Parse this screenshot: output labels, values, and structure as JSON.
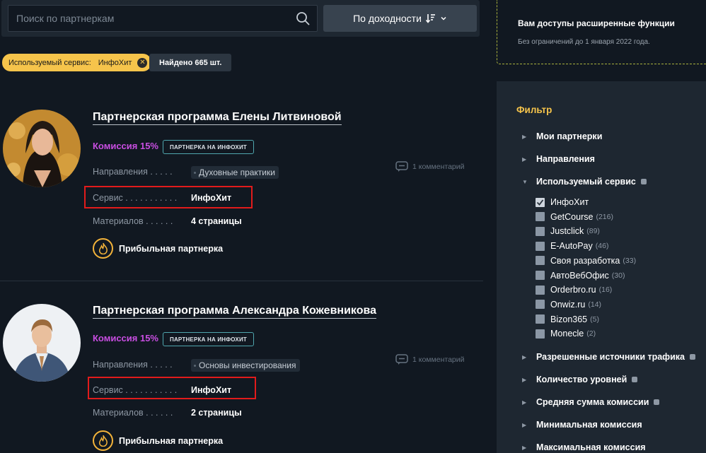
{
  "search": {
    "placeholder": "Поиск по партнеркам"
  },
  "sort": {
    "label": "По доходности"
  },
  "chips": {
    "service_label": "Используемый сервис:",
    "service_value": "ИнфоХит",
    "found": "Найдено 665 шт."
  },
  "cards": [
    {
      "title": "Партнерская программа Елены Литвиновой",
      "commission": "Комиссия 15%",
      "badge": "ПАРТНЕРКА НА ИНФОХИТ",
      "directions_label": "Направления . . . . .",
      "direction_tag": "Духовные практики",
      "service_label": "Сервис . . . . . . . . . . .",
      "service_value": "ИнфоХит",
      "materials_label": "Материалов . . . . . .",
      "materials_value": "4 страницы",
      "comments": "1 комментарий",
      "profit": "Прибыльная партнерка"
    },
    {
      "title": "Партнерская программа Александра Кожевникова",
      "commission": "Комиссия 15%",
      "badge": "ПАРТНЕРКА НА ИНФОХИТ",
      "directions_label": "Направления . . . . .",
      "direction_tag": "Основы инвестирования",
      "service_label": "Сервис . . . . . . . . . . .",
      "service_value": "ИнфоХит",
      "materials_label": "Материалов . . . . . .",
      "materials_value": "2 страницы",
      "comments": "1 комментарий",
      "profit": "Прибыльная партнерка"
    }
  ],
  "promo": {
    "title": "Вам доступы расширенные функции",
    "subtitle": "Без ограничений до 1 января 2022 года."
  },
  "filter": {
    "title": "Фильтр",
    "sections": [
      {
        "label": "Мои партнерки"
      },
      {
        "label": "Направления"
      },
      {
        "label": "Используемый сервис"
      },
      {
        "label": "Разрешенные источники трафика"
      },
      {
        "label": "Количество уровней"
      },
      {
        "label": "Средняя сумма комиссии"
      },
      {
        "label": "Минимальная комиссия"
      },
      {
        "label": "Максимальная комиссия"
      }
    ],
    "services": [
      {
        "label": "ИнфоХит",
        "count": "",
        "checked": true
      },
      {
        "label": "GetCourse",
        "count": "(216)",
        "checked": false
      },
      {
        "label": "Justclick",
        "count": "(89)",
        "checked": false
      },
      {
        "label": "E-AutoPay",
        "count": "(46)",
        "checked": false
      },
      {
        "label": "Своя разработка",
        "count": "(33)",
        "checked": false
      },
      {
        "label": "АвтоВебОфис",
        "count": "(30)",
        "checked": false
      },
      {
        "label": "Orderbro.ru",
        "count": "(16)",
        "checked": false
      },
      {
        "label": "Onwiz.ru",
        "count": "(14)",
        "checked": false
      },
      {
        "label": "Bizon365",
        "count": "(5)",
        "checked": false
      },
      {
        "label": "Monecle",
        "count": "(2)",
        "checked": false
      }
    ]
  },
  "colors": {
    "background": "#111821",
    "panel": "#1e2731",
    "accent_yellow": "#f6c44b",
    "commission_purple": "#c94ee2",
    "highlight_red": "#e21b1b"
  }
}
